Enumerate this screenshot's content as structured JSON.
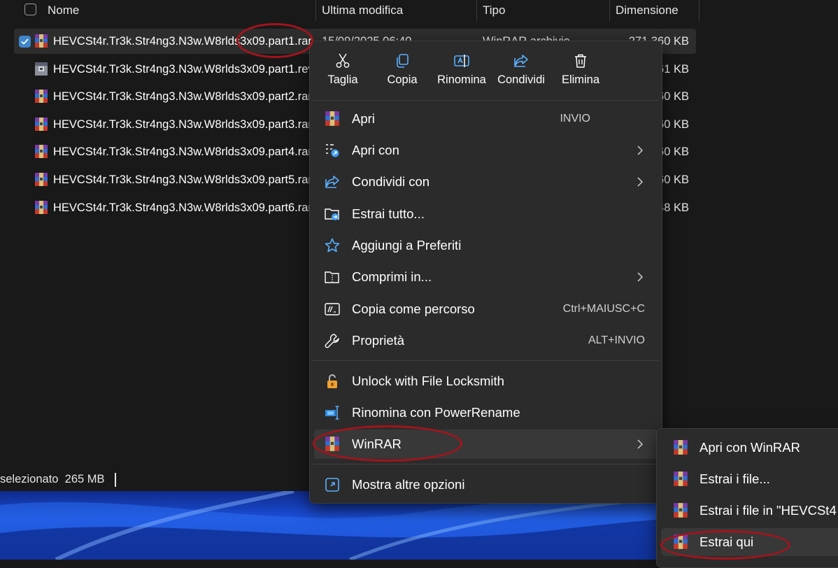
{
  "colors": {
    "accent": "#3f86cc",
    "annotation": "#a3141c",
    "menu_bg": "#2b2b2b",
    "list_bg": "#191919"
  },
  "columns": {
    "name": "Nome",
    "modified": "Ultima modifica",
    "type": "Tipo",
    "size": "Dimensione"
  },
  "files": [
    {
      "name": "HEVCSt4r.Tr3k.Str4ng3.N3w.W8rlds3x09.part1.rar",
      "modified": "15/09/2025 06:40",
      "type": "WinRAR archivio",
      "size": "271.360 KB",
      "icon": "winrar-archive-icon",
      "selected": true
    },
    {
      "name": "HEVCSt4r.Tr3k.Str4ng3.N3w.W8rlds3x09.part1.rev",
      "size": "61 KB",
      "icon": "winrar-recovery-icon"
    },
    {
      "name": "HEVCSt4r.Tr3k.Str4ng3.N3w.W8rlds3x09.part2.rar",
      "size": "60 KB",
      "icon": "winrar-archive-icon"
    },
    {
      "name": "HEVCSt4r.Tr3k.Str4ng3.N3w.W8rlds3x09.part3.rar",
      "size": "60 KB",
      "icon": "winrar-archive-icon"
    },
    {
      "name": "HEVCSt4r.Tr3k.Str4ng3.N3w.W8rlds3x09.part4.rar",
      "size": "60 KB",
      "icon": "winrar-archive-icon"
    },
    {
      "name": "HEVCSt4r.Tr3k.Str4ng3.N3w.W8rlds3x09.part5.rar",
      "size": "60 KB",
      "icon": "winrar-archive-icon"
    },
    {
      "name": "HEVCSt4r.Tr3k.Str4ng3.N3w.W8rlds3x09.part6.rar",
      "size": "48 KB",
      "icon": "winrar-archive-icon"
    }
  ],
  "status": {
    "selection": "selezionato",
    "size": "265 MB"
  },
  "quick_actions": [
    {
      "label": "Taglia",
      "icon": "scissors-icon"
    },
    {
      "label": "Copia",
      "icon": "copy-icon"
    },
    {
      "label": "Rinomina",
      "icon": "rename-icon"
    },
    {
      "label": "Condividi",
      "icon": "share-icon"
    },
    {
      "label": "Elimina",
      "icon": "trash-icon"
    }
  ],
  "menu": {
    "items": [
      {
        "label": "Apri",
        "shortcut": "INVIO",
        "icon": "winrar-icon"
      },
      {
        "label": "Apri con",
        "icon": "open-with-icon",
        "submenu": true
      },
      {
        "label": "Condividi con",
        "icon": "share-icon",
        "submenu": true
      },
      {
        "label": "Estrai tutto...",
        "icon": "extract-folder-icon"
      },
      {
        "label": "Aggiungi a Preferiti",
        "icon": "star-icon"
      },
      {
        "label": "Comprimi in...",
        "icon": "zip-folder-icon",
        "submenu": true
      },
      {
        "label": "Copia come percorso",
        "shortcut": "Ctrl+MAIUSC+C",
        "icon": "copy-path-icon"
      },
      {
        "label": "Proprietà",
        "shortcut": "ALT+INVIO",
        "icon": "wrench-icon"
      }
    ],
    "extensions": [
      {
        "label": "Unlock with File Locksmith",
        "icon": "padlock-icon"
      },
      {
        "label": "Rinomina con PowerRename",
        "icon": "power-rename-icon"
      },
      {
        "label": "WinRAR",
        "icon": "winrar-icon",
        "submenu": true
      }
    ],
    "more": {
      "label": "Mostra altre opzioni",
      "icon": "more-options-icon"
    }
  },
  "winrar_submenu": [
    {
      "label": "Apri con WinRAR",
      "icon": "winrar-icon"
    },
    {
      "label": "Estrai i file...",
      "icon": "winrar-icon"
    },
    {
      "label": "Estrai i file in \"HEVCSt4",
      "icon": "winrar-icon"
    },
    {
      "label": "Estrai qui",
      "icon": "winrar-icon"
    }
  ]
}
